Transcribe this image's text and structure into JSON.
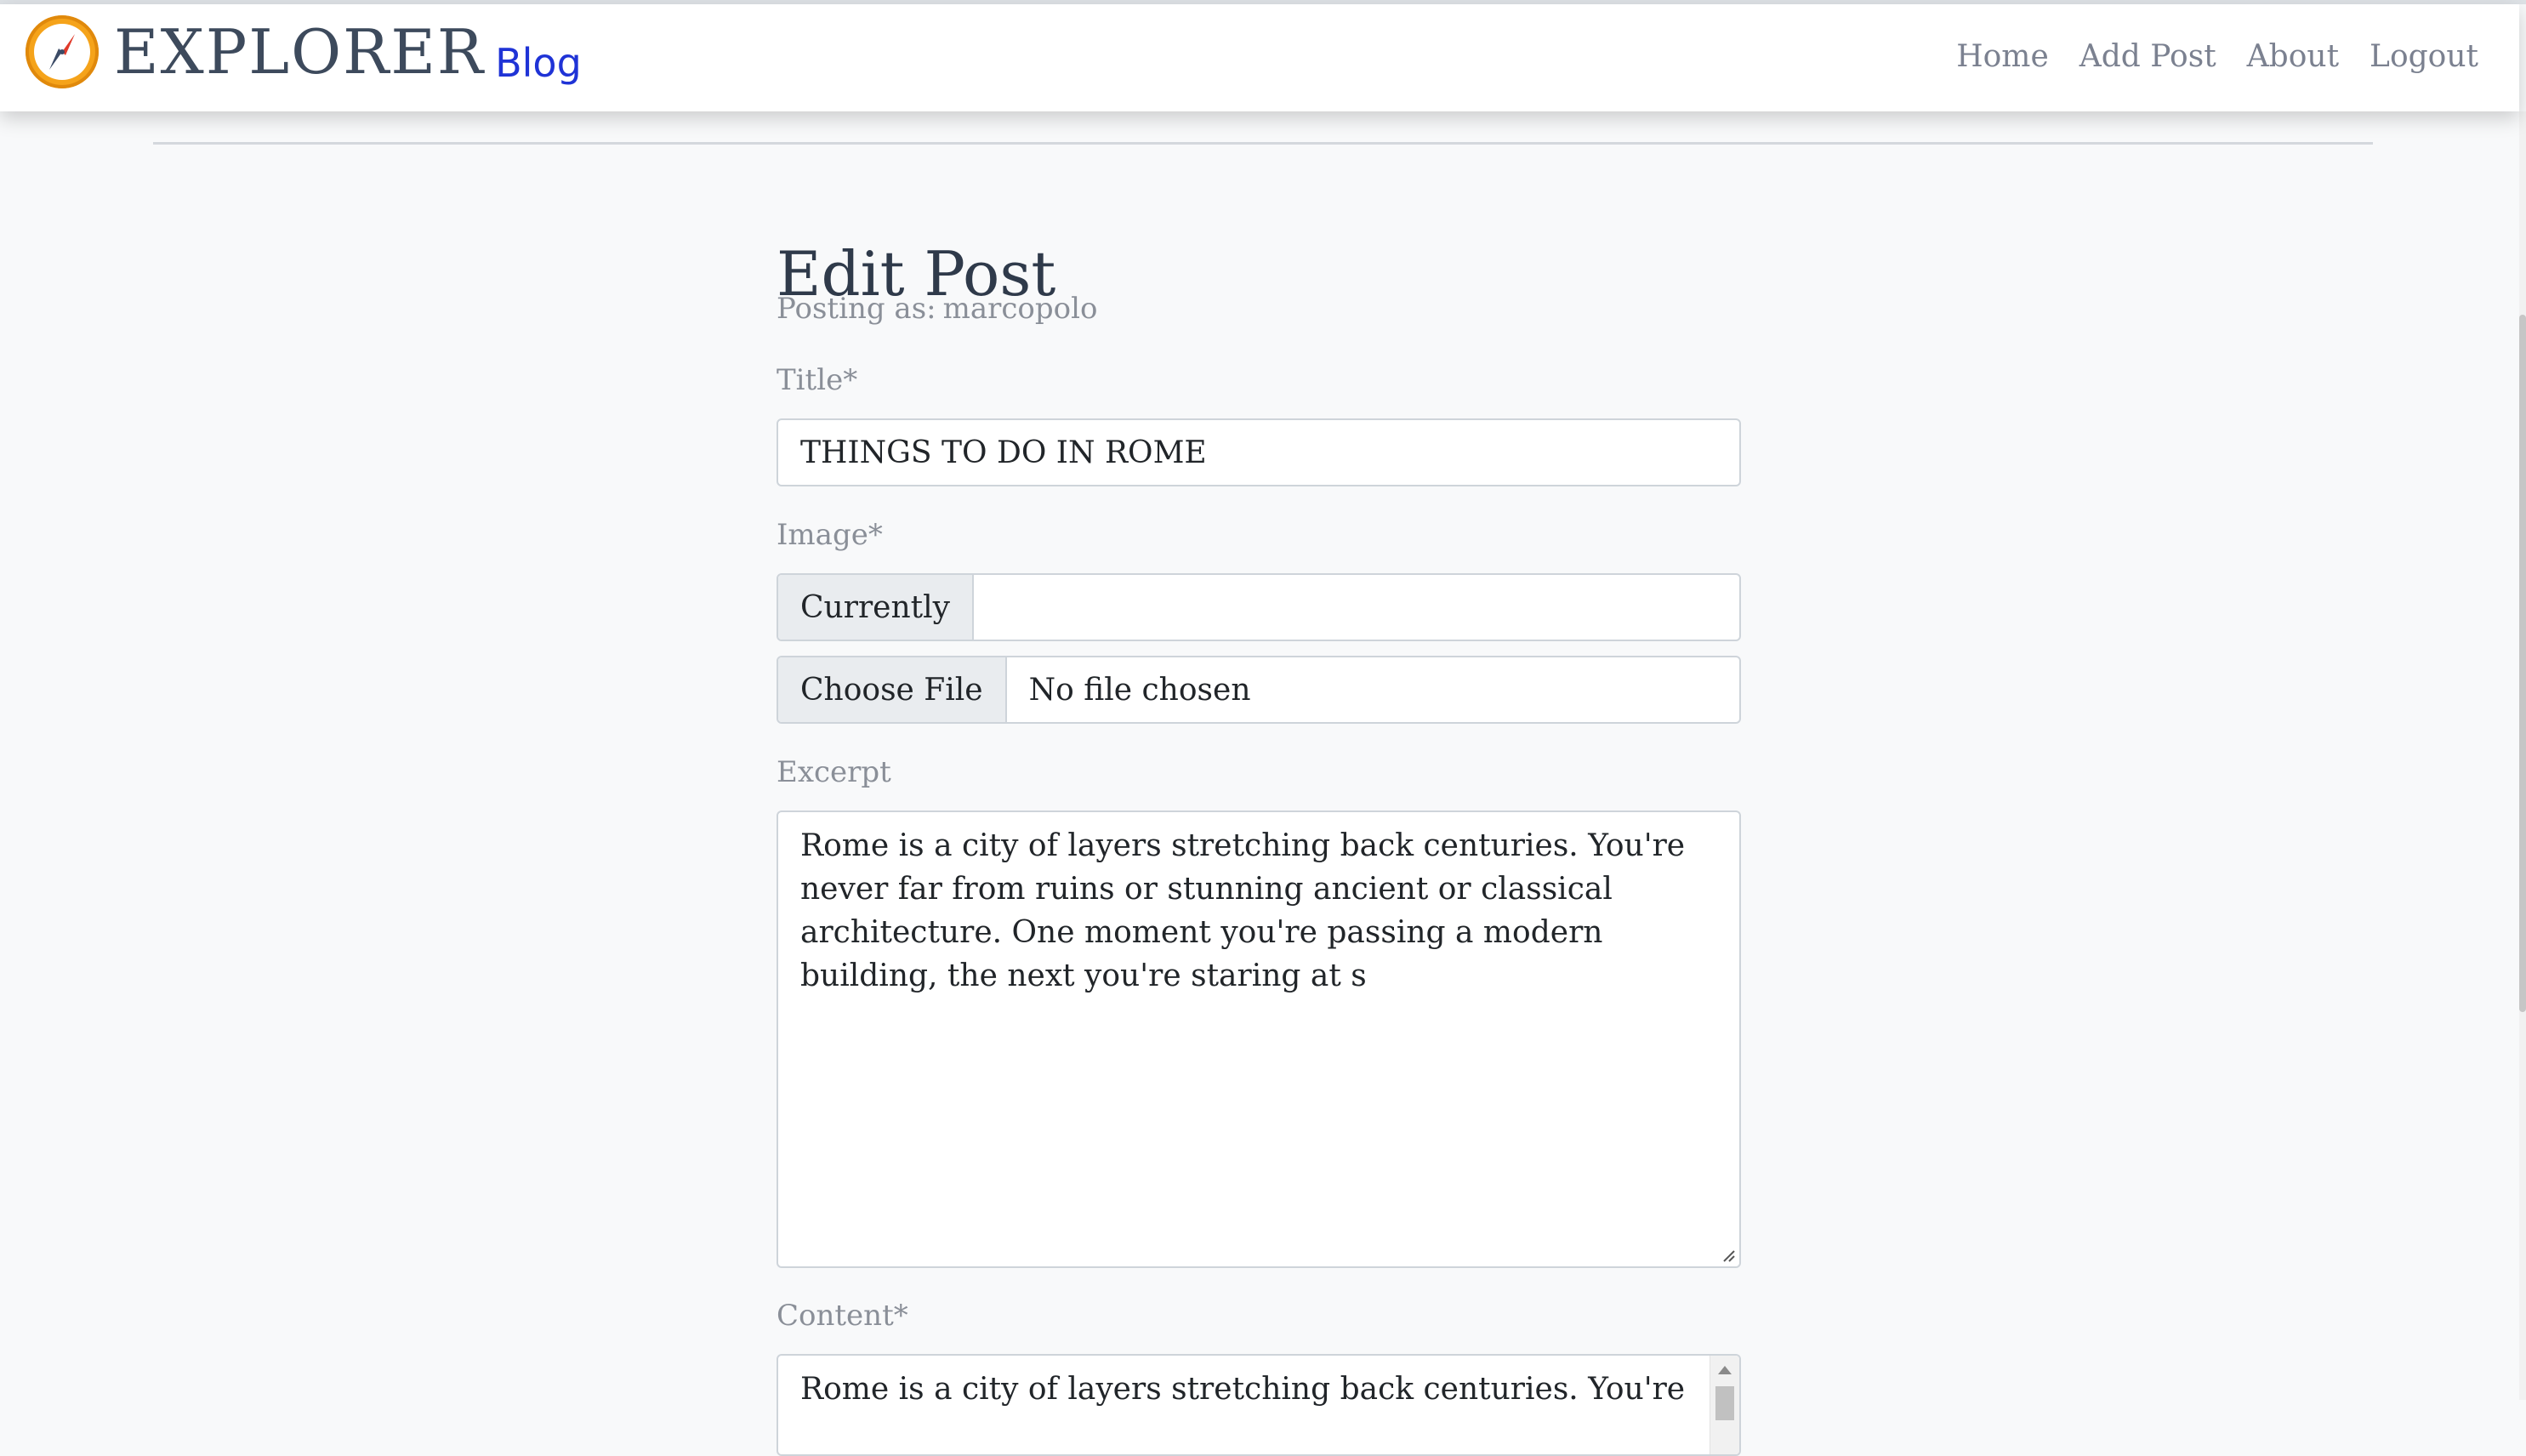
{
  "brand": {
    "name": "EXPLORER",
    "suffix": "Blog"
  },
  "nav": {
    "items": [
      "Home",
      "Add Post",
      "About",
      "Logout"
    ]
  },
  "form": {
    "heading": "Edit Post",
    "posting_as_label": "Posting as:",
    "posting_as_user": "marcopolo",
    "title_label": "Title*",
    "title_value": "THINGS TO DO IN ROME",
    "image_label": "Image*",
    "image_current_label": "Currently",
    "image_current_value": "",
    "choose_file_label": "Choose File",
    "no_file_text": "No file chosen",
    "excerpt_label": "Excerpt",
    "excerpt_value": "Rome is a city of layers stretching back centuries. You're never far from ruins or stunning ancient or classical architecture. One moment you're passing a modern building, the next you're staring at s",
    "content_label": "Content*",
    "content_value": "Rome is a city of layers stretching back centuries. You're"
  },
  "colors": {
    "brand_blue": "#1f33d6",
    "logo_orange": "#f5a31a",
    "heading": "#2f3a4a",
    "muted": "#8a8f98"
  },
  "icons": {
    "logo": "compass-icon",
    "resize": "resize-handle-icon",
    "scroll_up": "scroll-up-arrow-icon"
  }
}
